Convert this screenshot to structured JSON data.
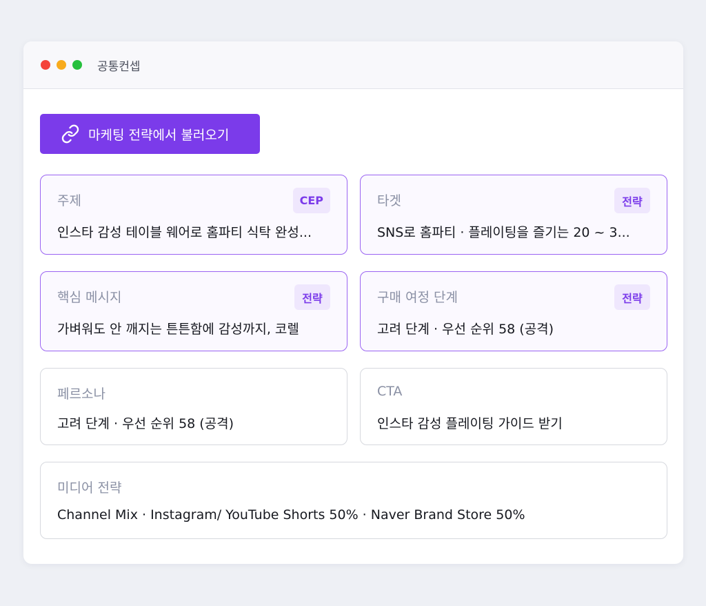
{
  "window": {
    "title": "공통컨셉"
  },
  "toolbar": {
    "import_label": "마케팅 전략에서 불러오기"
  },
  "cards": {
    "topic": {
      "label": "주제",
      "badge": "CEP",
      "value": "인스타 감성 테이블 웨어로 홈파티 식탁 완성..."
    },
    "target": {
      "label": "타겟",
      "badge": "전략",
      "value": "SNS로 홈파티 · 플레이팅을 즐기는 20 ~ 3..."
    },
    "message": {
      "label": "핵심 메시지",
      "badge": "전략",
      "value": "가벼워도 안 깨지는 튼튼함에 감성까지, 코렐"
    },
    "journey": {
      "label": "구매 여정 단계",
      "badge": "전략",
      "value": "고려 단계 · 우선 순위 58 (공격)"
    },
    "persona": {
      "label": "페르소나",
      "value": "고려 단계 · 우선 순위 58 (공격)"
    },
    "cta": {
      "label": "CTA",
      "value": "인스타 감성 플레이팅 가이드 받기"
    },
    "media": {
      "label": "미디어 전략",
      "value": "Channel Mix · Instagram/ YouTube Shorts 50% · Naver Brand Store 50%"
    }
  },
  "colors": {
    "accent": "#7b3bea",
    "badge_bg": "#efe7fd",
    "highlight_border": "#9a63f2"
  },
  "icons": {
    "window_controls": [
      "close-dot",
      "minimize-dot",
      "maximize-dot"
    ],
    "import": "link-icon"
  }
}
